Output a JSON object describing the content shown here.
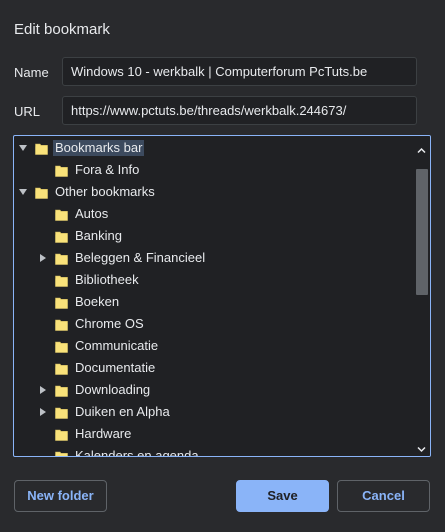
{
  "dialog": {
    "title": "Edit bookmark",
    "name_label": "Name",
    "name_value": "Windows 10 - werkbalk | Computerforum PcTuts.be",
    "url_label": "URL",
    "url_value": "https://www.pctuts.be/threads/werkbalk.244673/"
  },
  "tree": {
    "items": [
      {
        "label": "Bookmarks bar",
        "twisty": "expanded",
        "selected": true,
        "level": 0
      },
      {
        "label": "Fora & Info",
        "twisty": "none",
        "level": 1
      },
      {
        "label": "Other bookmarks",
        "twisty": "expanded",
        "level": 0
      },
      {
        "label": "Autos",
        "twisty": "none",
        "level": 1
      },
      {
        "label": "Banking",
        "twisty": "none",
        "level": 1
      },
      {
        "label": "Beleggen & Financieel",
        "twisty": "collapsed",
        "level": 1
      },
      {
        "label": "Bibliotheek",
        "twisty": "none",
        "level": 1
      },
      {
        "label": "Boeken",
        "twisty": "none",
        "level": 1
      },
      {
        "label": "Chrome OS",
        "twisty": "none",
        "level": 1
      },
      {
        "label": "Communicatie",
        "twisty": "none",
        "level": 1
      },
      {
        "label": "Documentatie",
        "twisty": "none",
        "level": 1
      },
      {
        "label": "Downloading",
        "twisty": "collapsed",
        "level": 1
      },
      {
        "label": "Duiken en Alpha",
        "twisty": "collapsed",
        "level": 1
      },
      {
        "label": "Hardware",
        "twisty": "none",
        "level": 1
      },
      {
        "label": "Kalenders en agenda",
        "twisty": "none",
        "level": 1
      }
    ],
    "scrollbar_position": 0.0,
    "folder_icon": "folder-icon",
    "folder_color": "#f9e27a"
  },
  "buttons": {
    "new_folder": "New folder",
    "save": "Save",
    "cancel": "Cancel"
  },
  "colors": {
    "background": "#292a2d",
    "accent": "#8ab4f8",
    "selection": "#3c4a5e"
  }
}
